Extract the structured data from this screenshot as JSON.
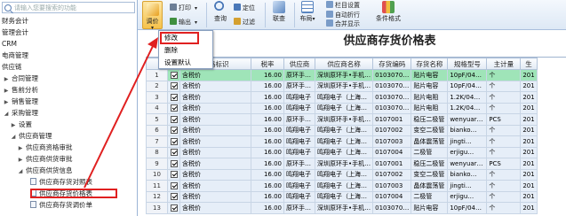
{
  "sidebar": {
    "search_placeholder": "请输入您要搜索的功能",
    "items": [
      {
        "label": "财务会计",
        "type": "plain"
      },
      {
        "label": "管理会计",
        "type": "plain"
      },
      {
        "label": "CRM",
        "type": "plain"
      },
      {
        "label": "电商管理",
        "type": "plain"
      },
      {
        "label": "供应链",
        "type": "plain"
      },
      {
        "label": "合同管理",
        "type": "collapsed"
      },
      {
        "label": "售前分析",
        "type": "collapsed"
      },
      {
        "label": "销售管理",
        "type": "collapsed"
      },
      {
        "label": "采购管理",
        "type": "expanded"
      },
      {
        "label": "设置",
        "type": "collapsed"
      },
      {
        "label": "供应商管理",
        "type": "expanded"
      },
      {
        "label": "供应商资格审批",
        "type": "collapsed"
      },
      {
        "label": "供应商供货审批",
        "type": "collapsed"
      },
      {
        "label": "供应商供货信息",
        "type": "expanded"
      },
      {
        "label": "供应商存货对照表",
        "type": "doc"
      },
      {
        "label": "供应商存货价格表",
        "type": "doc"
      },
      {
        "label": "供应商存货调价单",
        "type": "doc"
      }
    ]
  },
  "toolbar": {
    "tiaojia": "调价",
    "print": "打印",
    "output": "输出",
    "query": "查询",
    "locate": "定位",
    "filter": "过滤",
    "link": "联查",
    "layout": "布局",
    "col_settings": "栏目设置",
    "auto_wrap": "自动折行",
    "merge_show": "合并显示",
    "condition_format": "条件格式"
  },
  "menu": {
    "items": [
      "修改",
      "删除",
      "设置默认"
    ]
  },
  "sheet": {
    "title": "供应商存货价格表",
    "columns": [
      "",
      "",
      "价格标识",
      "税率",
      "供应商",
      "供应商名称",
      "存货编码",
      "存货名称",
      "规格型号",
      "主计量",
      "生"
    ],
    "rows": [
      {
        "n": "1",
        "flag": "含税价",
        "tax": "16.00",
        "vendor": "原环手…",
        "vname": "深圳原环手•手机…",
        "code": "0103070…",
        "name": "贴片电容",
        "spec": "10pF/04…",
        "unit": "个",
        "d": "201"
      },
      {
        "n": "2",
        "flag": "含税价",
        "tax": "16.00",
        "vendor": "原环手…",
        "vname": "深圳原环手•手机…",
        "code": "0103070…",
        "name": "贴片电容",
        "spec": "10pF/04…",
        "unit": "个",
        "d": "201"
      },
      {
        "n": "3",
        "flag": "含税价",
        "tax": "16.00",
        "vendor": "鸣翔电子",
        "vname": "鸣翔电子（上海…",
        "code": "0103070…",
        "name": "贴片电阻",
        "spec": "1.2K/04…",
        "unit": "个",
        "d": "201"
      },
      {
        "n": "4",
        "flag": "含税价",
        "tax": "16.00",
        "vendor": "鸣翔电子",
        "vname": "鸣翔电子（上海…",
        "code": "0103070…",
        "name": "贴片电阻",
        "spec": "1.2K/04…",
        "unit": "个",
        "d": "201"
      },
      {
        "n": "5",
        "flag": "含税价",
        "tax": "16.00",
        "vendor": "原环手…",
        "vname": "深圳原环手•手机…",
        "code": "0107001",
        "name": "稳压二极管",
        "spec": "wenyuar…",
        "unit": "PCS",
        "d": "201"
      },
      {
        "n": "6",
        "flag": "含税价",
        "tax": "16.00",
        "vendor": "鸣翔电子",
        "vname": "鸣翔电子（上海…",
        "code": "0107002",
        "name": "变空二极管",
        "spec": "bianko…",
        "unit": "个",
        "d": "201"
      },
      {
        "n": "7",
        "flag": "含税价",
        "tax": "16.00",
        "vendor": "鸣翔电子",
        "vname": "鸣翔电子（上海…",
        "code": "0107003",
        "name": "晶体震荡管",
        "spec": "jingti…",
        "unit": "个",
        "d": "201"
      },
      {
        "n": "8",
        "flag": "含税价",
        "tax": "16.00",
        "vendor": "鸣翔电子",
        "vname": "鸣翔电子（上海…",
        "code": "0107004",
        "name": "二极管",
        "spec": "erjigu…",
        "unit": "个",
        "d": "201"
      },
      {
        "n": "9",
        "flag": "含税价",
        "tax": "16.00",
        "vendor": "原环手…",
        "vname": "深圳原环手•手机…",
        "code": "0107001",
        "name": "稳压二极管",
        "spec": "wenyuar…",
        "unit": "PCS",
        "d": "201"
      },
      {
        "n": "10",
        "flag": "含税价",
        "tax": "16.00",
        "vendor": "鸣翔电子",
        "vname": "鸣翔电子（上海…",
        "code": "0107002",
        "name": "变空二极管",
        "spec": "bianko…",
        "unit": "个",
        "d": "201"
      },
      {
        "n": "11",
        "flag": "含税价",
        "tax": "16.00",
        "vendor": "鸣翔电子",
        "vname": "鸣翔电子（上海…",
        "code": "0107003",
        "name": "晶体震荡管",
        "spec": "jingti…",
        "unit": "个",
        "d": "201"
      },
      {
        "n": "12",
        "flag": "含税价",
        "tax": "16.00",
        "vendor": "鸣翔电子",
        "vname": "鸣翔电子（上海…",
        "code": "0107004",
        "name": "二极管",
        "spec": "erjigu…",
        "unit": "个",
        "d": "201"
      },
      {
        "n": "13",
        "flag": "含税价",
        "tax": "16.00",
        "vendor": "原环手…",
        "vname": "深圳原环手•手机…",
        "code": "0103070…",
        "name": "贴片电容",
        "spec": "10pF/04…",
        "unit": "个",
        "d": "201"
      }
    ]
  },
  "colors": {
    "row_bg": "#e6eef8",
    "selected_row_bg": "#9fe4b8",
    "highlight_red": "#e02020"
  }
}
